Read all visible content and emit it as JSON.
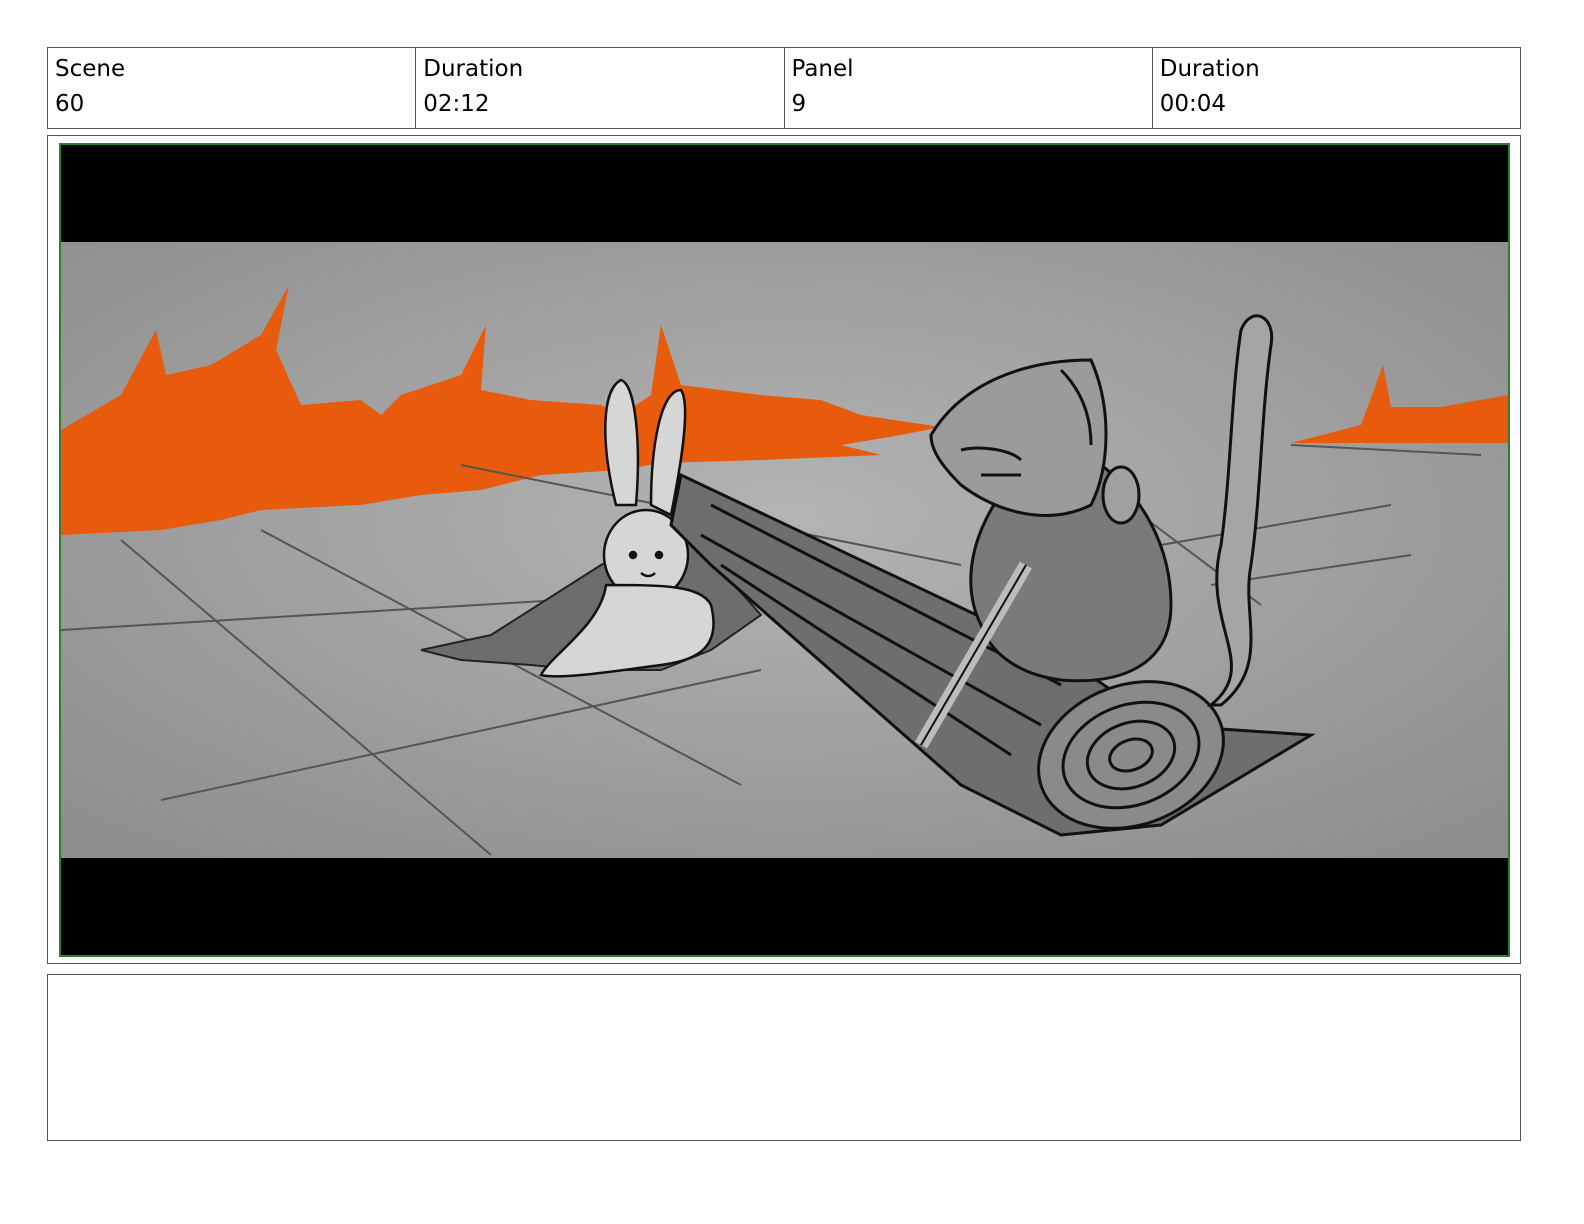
{
  "header": {
    "scene": {
      "label": "Scene",
      "value": "60"
    },
    "scene_duration": {
      "label": "Duration",
      "value": "02:12"
    },
    "panel": {
      "label": "Panel",
      "value": "9"
    },
    "panel_duration": {
      "label": "Duration",
      "value": "00:04"
    }
  },
  "panel_image": {
    "description_icon": "storyboard-sketch-image"
  },
  "notes": {
    "text": ""
  },
  "colors": {
    "frame_border": "#2e7d32",
    "flame": "#e85a0c",
    "ground": "#9a9a9a",
    "letterbox": "#000000"
  }
}
